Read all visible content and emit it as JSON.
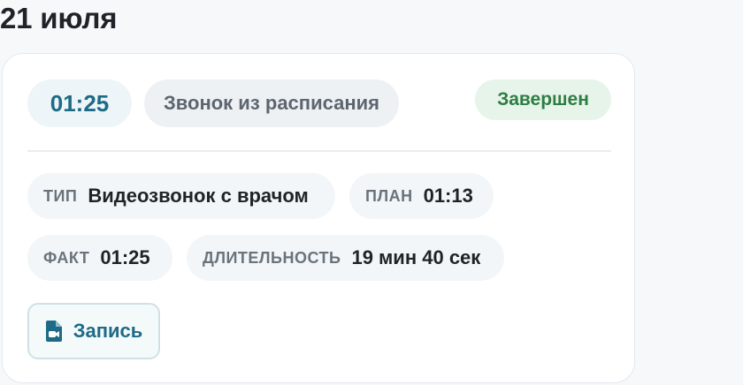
{
  "date_heading": "21 июля",
  "call": {
    "time": "01:25",
    "source": "Звонок из расписания",
    "status": "Завершен",
    "details": {
      "type_label": "ТИП",
      "type_value": "Видеозвонок с врачом",
      "plan_label": "ПЛАН",
      "plan_value": "01:13",
      "fact_label": "ФАКТ",
      "fact_value": "01:25",
      "duration_label": "ДЛИТЕЛЬНОСТЬ",
      "duration_value": "19 мин 40 сек"
    },
    "record_button": {
      "label": "Запись",
      "icon": "video-file-icon"
    }
  },
  "colors": {
    "accent": "#1d6b86",
    "status_green": "#2e7d43",
    "status_bg": "#e6f4ea"
  }
}
